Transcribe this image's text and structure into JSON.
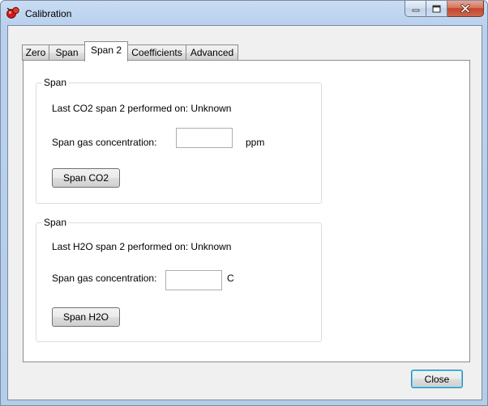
{
  "window": {
    "title": "Calibration"
  },
  "tabs": [
    {
      "label": "Zero"
    },
    {
      "label": "Span"
    },
    {
      "label": "Span 2"
    },
    {
      "label": "Coefficients"
    },
    {
      "label": "Advanced"
    }
  ],
  "co2_group": {
    "legend": "Span",
    "last_span_text": "Last CO2 span 2 performed on: Unknown",
    "concentration_label": "Span gas concentration:",
    "concentration_value": "",
    "unit": "ppm",
    "button_label": "Span CO2"
  },
  "h2o_group": {
    "legend": "Span",
    "last_span_text": "Last H2O span 2 performed on: Unknown",
    "concentration_label": "Span gas concentration:",
    "concentration_value": "",
    "unit": "C",
    "button_label": "Span H2O"
  },
  "footer": {
    "close_label": "Close"
  },
  "icons": {
    "app": "calibration-app-icon",
    "minimize": "minimize-icon",
    "maximize": "maximize-icon",
    "close": "close-icon"
  }
}
